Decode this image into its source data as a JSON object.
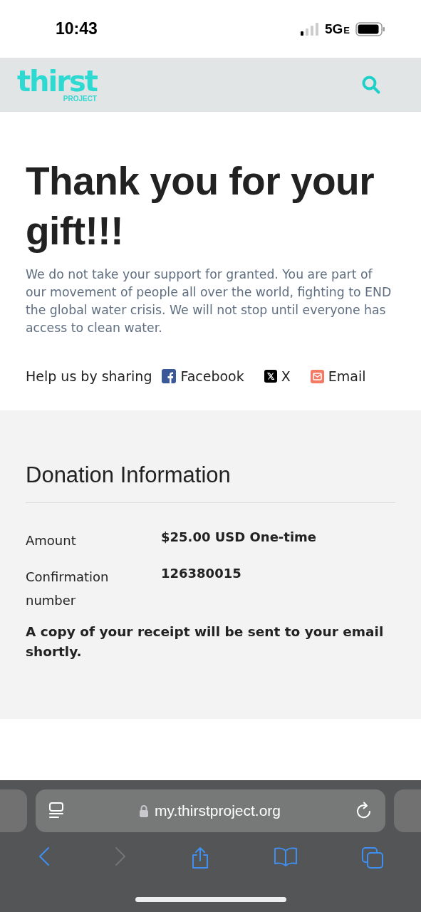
{
  "status_bar": {
    "time": "10:43",
    "network": "5G",
    "network_suffix": "E"
  },
  "header": {
    "logo": {
      "word": "thirst",
      "sub": "PROJECT"
    }
  },
  "thank_you": {
    "title": "Thank you for your gift!!!",
    "message": "We do not take your support for granted. You are part of our movement of people all over the world, fighting to END the global water crisis. We will not stop until everyone has access to clean water."
  },
  "share": {
    "label": "Help us by sharing",
    "links": [
      {
        "kind": "facebook",
        "label": "Facebook"
      },
      {
        "kind": "x",
        "label": "X"
      },
      {
        "kind": "email",
        "label": "Email"
      }
    ]
  },
  "donation": {
    "title": "Donation Information",
    "rows": [
      {
        "label": "Amount",
        "value": "$25.00 USD One-time"
      },
      {
        "label": "Confirmation number",
        "value": "126380015"
      }
    ],
    "note": "A copy of your receipt will be sent to your email shortly."
  },
  "browser": {
    "url": "my.thirstproject.org",
    "toolbar": [
      {
        "kind": "back",
        "disabled": false
      },
      {
        "kind": "forward",
        "disabled": true
      },
      {
        "kind": "share",
        "disabled": false
      },
      {
        "kind": "bookmarks",
        "disabled": false
      },
      {
        "kind": "tabs",
        "disabled": false
      }
    ]
  }
}
